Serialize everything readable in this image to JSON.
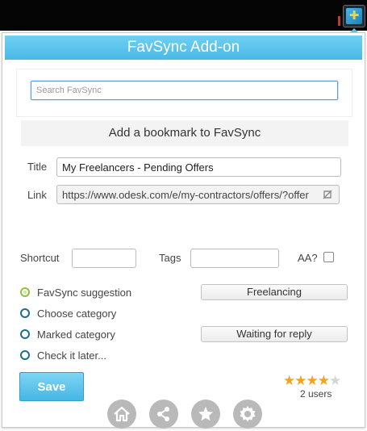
{
  "popup": {
    "title": "FavSync Add-on",
    "search_placeholder": "Search FavSync",
    "section_title": "Add a bookmark to FavSync",
    "title_label": "Title",
    "title_value": "My Freelancers - Pending Offers",
    "link_label": "Link",
    "link_value": "https://www.odesk.com/e/my-contractors/offers/?offer",
    "shortcut_label": "Shortcut",
    "shortcut_value": "",
    "tags_label": "Tags",
    "tags_value": "",
    "aa_label": "AA?",
    "options": [
      {
        "label": "FavSync suggestion",
        "category": "Freelancing"
      },
      {
        "label": "Choose category",
        "category": ""
      },
      {
        "label": "Marked category",
        "category": "Waiting for reply"
      },
      {
        "label": "Check it later...",
        "category": ""
      }
    ],
    "save_label": "Save",
    "rating": {
      "value": 4,
      "max": 5,
      "users_label": "2 users"
    },
    "footer_icons": [
      "home-icon",
      "share-icon",
      "favorites-icon",
      "settings-icon"
    ]
  },
  "colors": {
    "accent": "#4ab8e6",
    "star": "#f3a41c",
    "radio_selected": "#8fc23a",
    "radio": "#1d6e8c"
  }
}
